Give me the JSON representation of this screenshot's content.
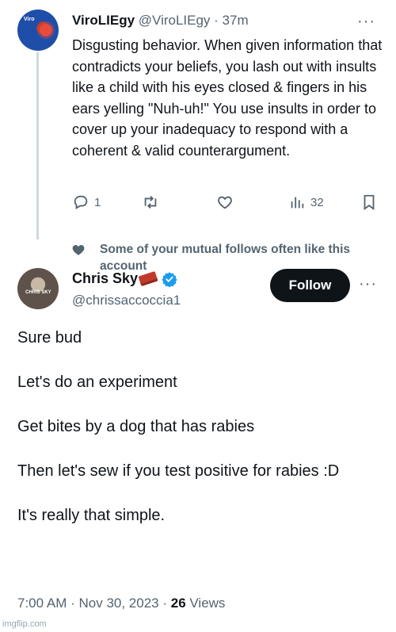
{
  "tweet1": {
    "avatar_text": "Viro",
    "display_name": "ViroLIEgy",
    "handle": "@ViroLIEgy",
    "separator": " · ",
    "time_ago": "37m",
    "body": "Disgusting behavior. When given information that contradicts your beliefs, you lash out with insults like a child with his eyes closed & fingers in his ears yelling \"Nuh-uh!\" You use insults in order to cover up your inadequacy to respond with a coherent & valid counterargument.",
    "actions": {
      "reply_icon": "reply-icon",
      "reply_count": "1",
      "retweet_icon": "retweet-icon",
      "like_icon": "heart-icon",
      "views_icon": "bar-chart-icon",
      "views_count": "32",
      "bookmark_icon": "bookmark-icon"
    },
    "more_label": "···"
  },
  "social_context": {
    "icon": "heart-icon",
    "text": "Some of your mutual follows often like this account"
  },
  "tweet2": {
    "avatar_text": "CHRIS SKY",
    "display_name": "Chris Sky",
    "name_emoji": "brick-icon",
    "verified_icon": "verified-badge-icon",
    "handle": "@chrissaccoccia1",
    "follow_label": "Follow",
    "more_label": "···",
    "body": [
      "Sure bud",
      "Let's do an experiment",
      "Get bites by a dog that has rabies",
      "Then let's sew if you test positive for rabies :D",
      "It's really that simple."
    ],
    "time": "7:00 AM",
    "date": "Nov 30, 2023",
    "views_count": "26",
    "views_label": "Views"
  },
  "watermark": "imgflip.com",
  "colors": {
    "text": "#0f1419",
    "secondary": "#536471",
    "verified": "#1d9bf0",
    "follow_bg": "#0f1419"
  }
}
